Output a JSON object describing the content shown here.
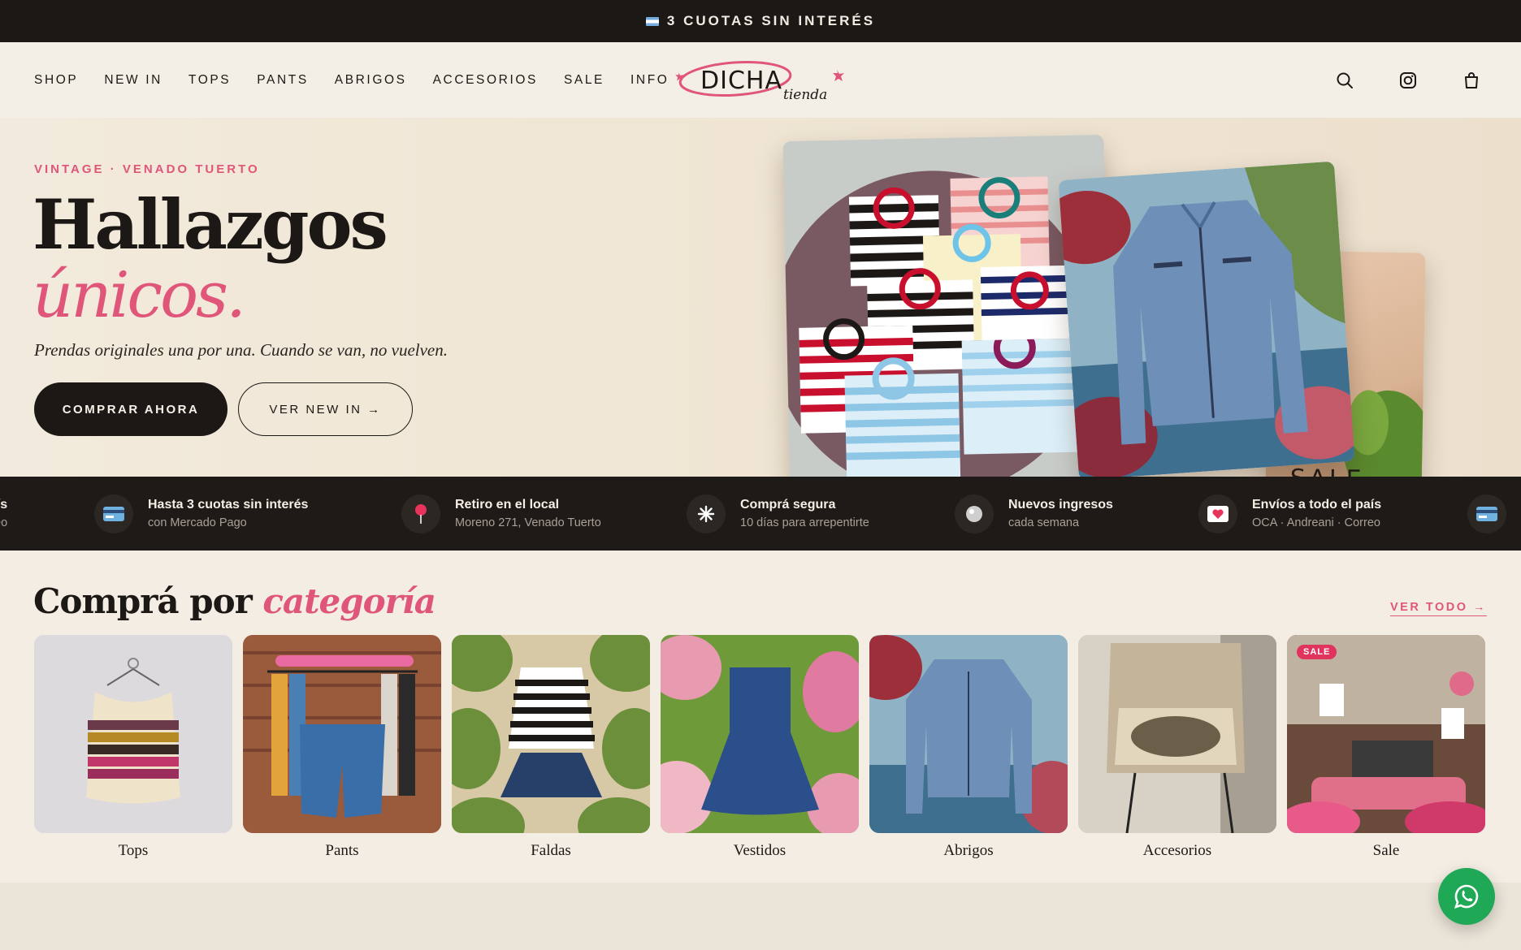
{
  "announcement": {
    "text": "3 CUOTAS SIN INTERÉS"
  },
  "nav": {
    "items": [
      "SHOP",
      "NEW IN",
      "TOPS",
      "PANTS",
      "ABRIGOS",
      "ACCESORIOS",
      "SALE",
      "INFO"
    ]
  },
  "logo": {
    "main": "DICHA",
    "sub": "tienda"
  },
  "header_icons": [
    "search-icon",
    "instagram-icon",
    "shopping-bag-icon"
  ],
  "hero": {
    "eyebrow": "VINTAGE · VENADO TUERTO",
    "title_line1": "Hallazgos",
    "title_line2": "únicos.",
    "subtitle": "Prendas originales una por una. Cuando se van, no vuelven.",
    "cta_primary": "COMPRAR AHORA",
    "cta_secondary": "VER NEW IN →",
    "collage_sign": "SALE"
  },
  "marquee": {
    "items": [
      {
        "title": "Envíos a todo el país",
        "subtitle": "OCA · Andreani · Correo",
        "icon": "heart-card-icon"
      },
      {
        "title": "Hasta 3 cuotas sin interés",
        "subtitle": "con Mercado Pago",
        "icon": "credit-card-icon"
      },
      {
        "title": "Retiro en el local",
        "subtitle": "Moreno 271, Venado Tuerto",
        "icon": "pin-icon"
      },
      {
        "title": "Comprá segura",
        "subtitle": "10 días para arrepentirte",
        "icon": "sparkle-icon"
      },
      {
        "title": "Nuevos ingresos",
        "subtitle": "cada semana",
        "icon": "disc-icon"
      },
      {
        "title": "Envíos a todo el país",
        "subtitle": "OCA · Andreani · Correo",
        "icon": "heart-card-icon"
      },
      {
        "title": "",
        "subtitle": "",
        "icon": "credit-card-icon"
      }
    ]
  },
  "categories": {
    "title_plain": "Comprá por",
    "title_accent": "categoría",
    "see_all": "VER TODO →",
    "items": [
      {
        "label": "Tops"
      },
      {
        "label": "Pants"
      },
      {
        "label": "Faldas"
      },
      {
        "label": "Vestidos"
      },
      {
        "label": "Abrigos"
      },
      {
        "label": "Accesorios"
      },
      {
        "label": "Sale",
        "badge": "SALE"
      }
    ]
  },
  "colors": {
    "dark": "#1c1815",
    "accent": "#e0567a",
    "cream": "#efe7da",
    "whatsapp": "#1fa855"
  }
}
